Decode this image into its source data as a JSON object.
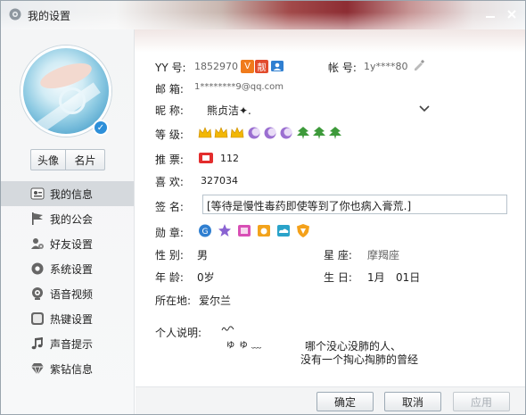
{
  "window": {
    "title": "我的设置",
    "minimize_icon": "minimize-icon",
    "close_icon": "close-icon"
  },
  "sidebar": {
    "avatar_badge_icon": "twitter-bird-icon",
    "tabs": [
      {
        "label": "头像"
      },
      {
        "label": "名片"
      }
    ],
    "items": [
      {
        "label": "我的信息",
        "icon": "profile-card-icon",
        "active": true
      },
      {
        "label": "我的公会",
        "icon": "flag-icon",
        "active": false
      },
      {
        "label": "好友设置",
        "icon": "user-gear-icon",
        "active": false
      },
      {
        "label": "系统设置",
        "icon": "gear-icon",
        "active": false
      },
      {
        "label": "语音视频",
        "icon": "webcam-icon",
        "active": false
      },
      {
        "label": "热键设置",
        "icon": "hotkey-icon",
        "active": false
      },
      {
        "label": "声音提示",
        "icon": "music-note-icon",
        "active": false
      },
      {
        "label": "紫钻信息",
        "icon": "diamond-icon",
        "active": false
      }
    ]
  },
  "profile": {
    "yy_label": "YY 号:",
    "yy_value": "1852970",
    "yy_badges": [
      "V",
      "靓"
    ],
    "account_label": "帐 号:",
    "account_value": "1y****80",
    "email_label": "邮 箱:",
    "email_value": "1********9@qq.com",
    "nickname_label": "昵 称:",
    "nickname_value": "熊贞洁✦.",
    "level_label": "等 级:",
    "recommend_label": "推 票:",
    "recommend_value": "112",
    "like_label": "喜 欢:",
    "like_value": "327034",
    "signature_label": "签 名:",
    "signature_value": "[等待是慢性毒药即使等到了你也病入膏荒.]",
    "medal_label": "勋 章:",
    "gender_label": "性 别:",
    "gender_value": "男",
    "constellation_label": "星 座:",
    "constellation_value": "摩羯座",
    "age_label": "年 龄:",
    "age_value": "0岁",
    "birthday_label": "生 日:",
    "birthday_month": "1月",
    "birthday_day": "01日",
    "location_label": "所在地:",
    "location_value": "爱尔兰",
    "about_label": "个人说明:",
    "about_line1": "ゅ ゅ ﹏",
    "about_line2": "哪个没心没肺的人、",
    "about_line3": "没有一个掏心掏肺的曾经"
  },
  "footer": {
    "ok_label": "确定",
    "cancel_label": "取消",
    "apply_label": "应用"
  },
  "colors": {
    "nav_active": "#d5d9dd",
    "crown": "#f2b705",
    "moon": "#9b6fd1",
    "leaf": "#3d9a3a"
  }
}
